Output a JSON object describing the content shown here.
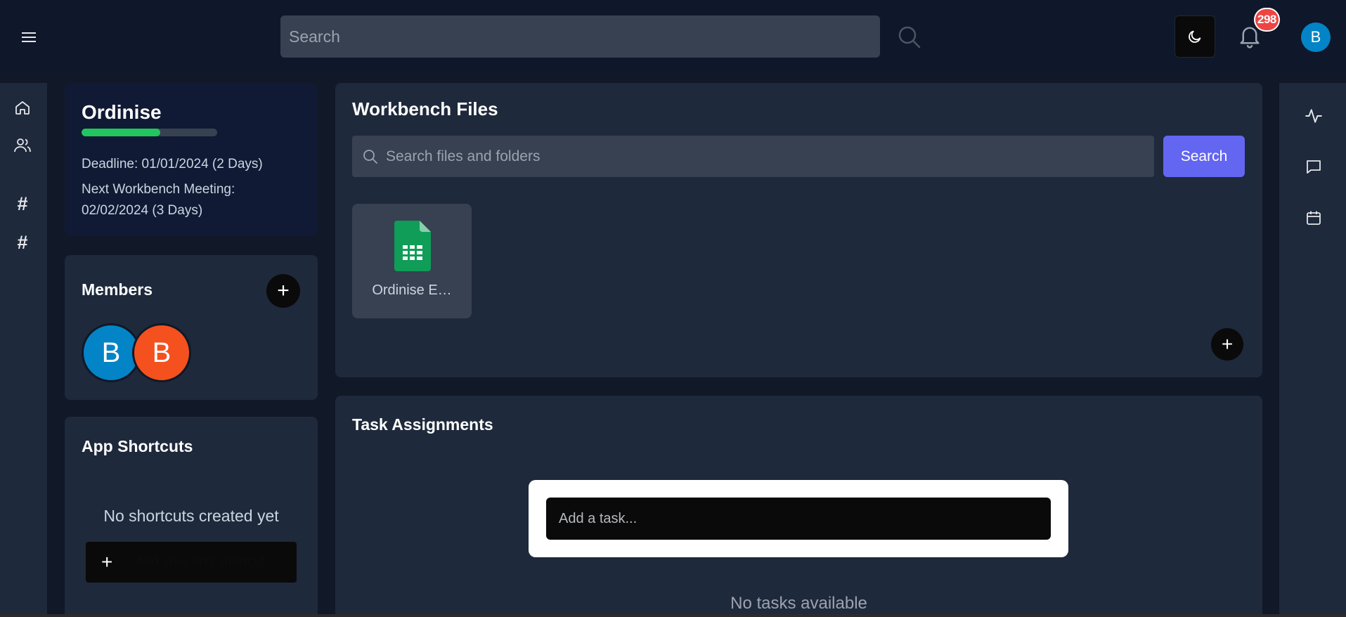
{
  "topbar": {
    "search_placeholder": "Search",
    "notification_count": "298",
    "user_initial": "B",
    "icons": {
      "menu": "hamburger-icon",
      "search": "search-icon",
      "theme": "moon-icon",
      "notifications": "bell-icon"
    }
  },
  "left_nav": {
    "items": [
      {
        "icon": "home-icon"
      },
      {
        "icon": "users-icon"
      },
      {
        "icon": "hash-icon",
        "glyph": "#"
      },
      {
        "icon": "hash-icon",
        "glyph": "#"
      }
    ]
  },
  "right_nav": {
    "items": [
      {
        "icon": "activity-icon"
      },
      {
        "icon": "chat-icon"
      },
      {
        "icon": "calendar-icon"
      }
    ]
  },
  "project": {
    "title": "Ordinise",
    "progress_percent": 58,
    "deadline": "Deadline: 01/01/2024 (2 Days)",
    "next_meeting_label": "Next Workbench Meeting:",
    "next_meeting_date": "02/02/2024 (3 Days)",
    "progress_color": "#22c55e"
  },
  "members": {
    "title": "Members",
    "add_glyph": "+",
    "list": [
      {
        "initial": "B",
        "color": "#0284c7"
      },
      {
        "initial": "B",
        "color": "#f4511e"
      }
    ]
  },
  "shortcuts": {
    "title": "App Shortcuts",
    "empty_text": "No shortcuts created yet",
    "add_glyph": "+",
    "add_label": "Add your first shortcut"
  },
  "files": {
    "title": "Workbench Files",
    "search_placeholder": "Search files and folders",
    "search_button": "Search",
    "add_glyph": "+",
    "items": [
      {
        "name": "Ordinise E…",
        "icon": "google-sheets-icon"
      }
    ],
    "accent_color": "#6366f1"
  },
  "tasks": {
    "title": "Task Assignments",
    "input_placeholder": "Add a task...",
    "empty_text": "No tasks available"
  }
}
